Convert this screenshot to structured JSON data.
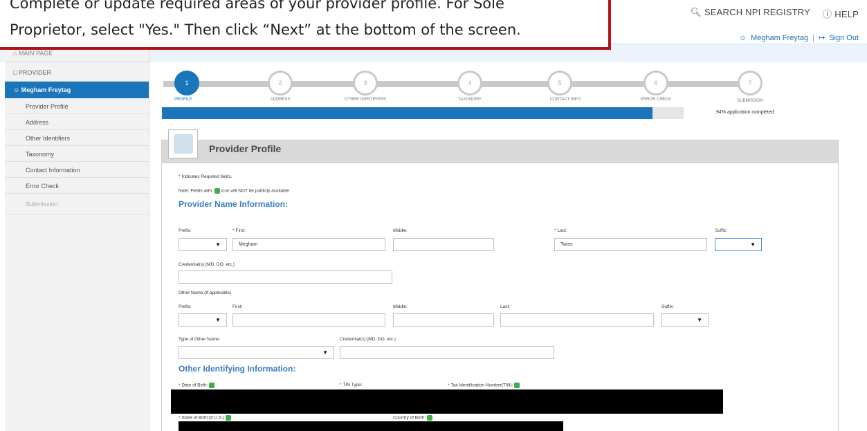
{
  "callout": {
    "line1": "Complete or update required areas of your provider profile. For Sole",
    "line2": "Proprietor, select \"Yes.\" Then click “Next” at the bottom of the screen."
  },
  "topnav": {
    "search_label": "SEARCH NPI REGISTRY",
    "help_label": "HELP",
    "user_name": "Megham Freytag",
    "sign_out": "Sign Out"
  },
  "sidebar": {
    "main_page": "MAIN PAGE",
    "provider": "PROVIDER",
    "user": "Megham Freytag",
    "items": [
      {
        "label": "Provider Profile"
      },
      {
        "label": "Address"
      },
      {
        "label": "Other Identifiers"
      },
      {
        "label": "Taxonomy"
      },
      {
        "label": "Contact Information"
      },
      {
        "label": "Error Check"
      },
      {
        "label": "Submission"
      }
    ]
  },
  "steps": [
    {
      "num": "1",
      "label": "PROFILE",
      "active": true
    },
    {
      "num": "2",
      "label": "ADDRESS"
    },
    {
      "num": "3",
      "label": "OTHER IDENTIFIERS"
    },
    {
      "num": "4",
      "label": "TAXONOMY"
    },
    {
      "num": "5",
      "label": "CONTACT INFO"
    },
    {
      "num": "6",
      "label": "ERROR CHECK"
    },
    {
      "num": "7",
      "label": "SUBMISSION"
    }
  ],
  "progress": {
    "percent": 94,
    "text": "94% application completed"
  },
  "card": {
    "title": "Provider Profile",
    "required_note": "Indicates Required fields.",
    "privacy_note_a": "Note: Fields with",
    "privacy_note_b": "icon will NOT be publicly available"
  },
  "name_info": {
    "title": "Provider Name Information:",
    "prefix_label": "Prefix:",
    "first_label": "First:",
    "first_value": "Megham",
    "middle_label": "Middle:",
    "last_label": "Last:",
    "last_value": "Twiss",
    "suffix_label": "Suffix:",
    "credential_label": "Credential(s):(MD, DO, etc.)"
  },
  "other_name": {
    "title": "Other Name:(If applicable)",
    "prefix_label": "Prefix:",
    "first_label": "First:",
    "middle_label": "Middle:",
    "last_label": "Last:",
    "suffix_label": "Suffix:",
    "type_label": "Type of Other Name:",
    "credential_label": "Credential(s):(MD, DO, etc.)"
  },
  "other_id": {
    "title": "Other Identifying Information:",
    "dob_label": "Date of Birth:",
    "tin_type_label": "TIN Type:",
    "tin_label": "Tax Identification Number(TIN):",
    "state_birth_label": "State of Birth:(If U.S.)",
    "country_birth_label": "Country of Birth:"
  },
  "colors": {
    "accent": "#1a75bb",
    "callout_border": "#b3121b",
    "section_title": "#3a7cc2",
    "lock": "#3fae49"
  }
}
